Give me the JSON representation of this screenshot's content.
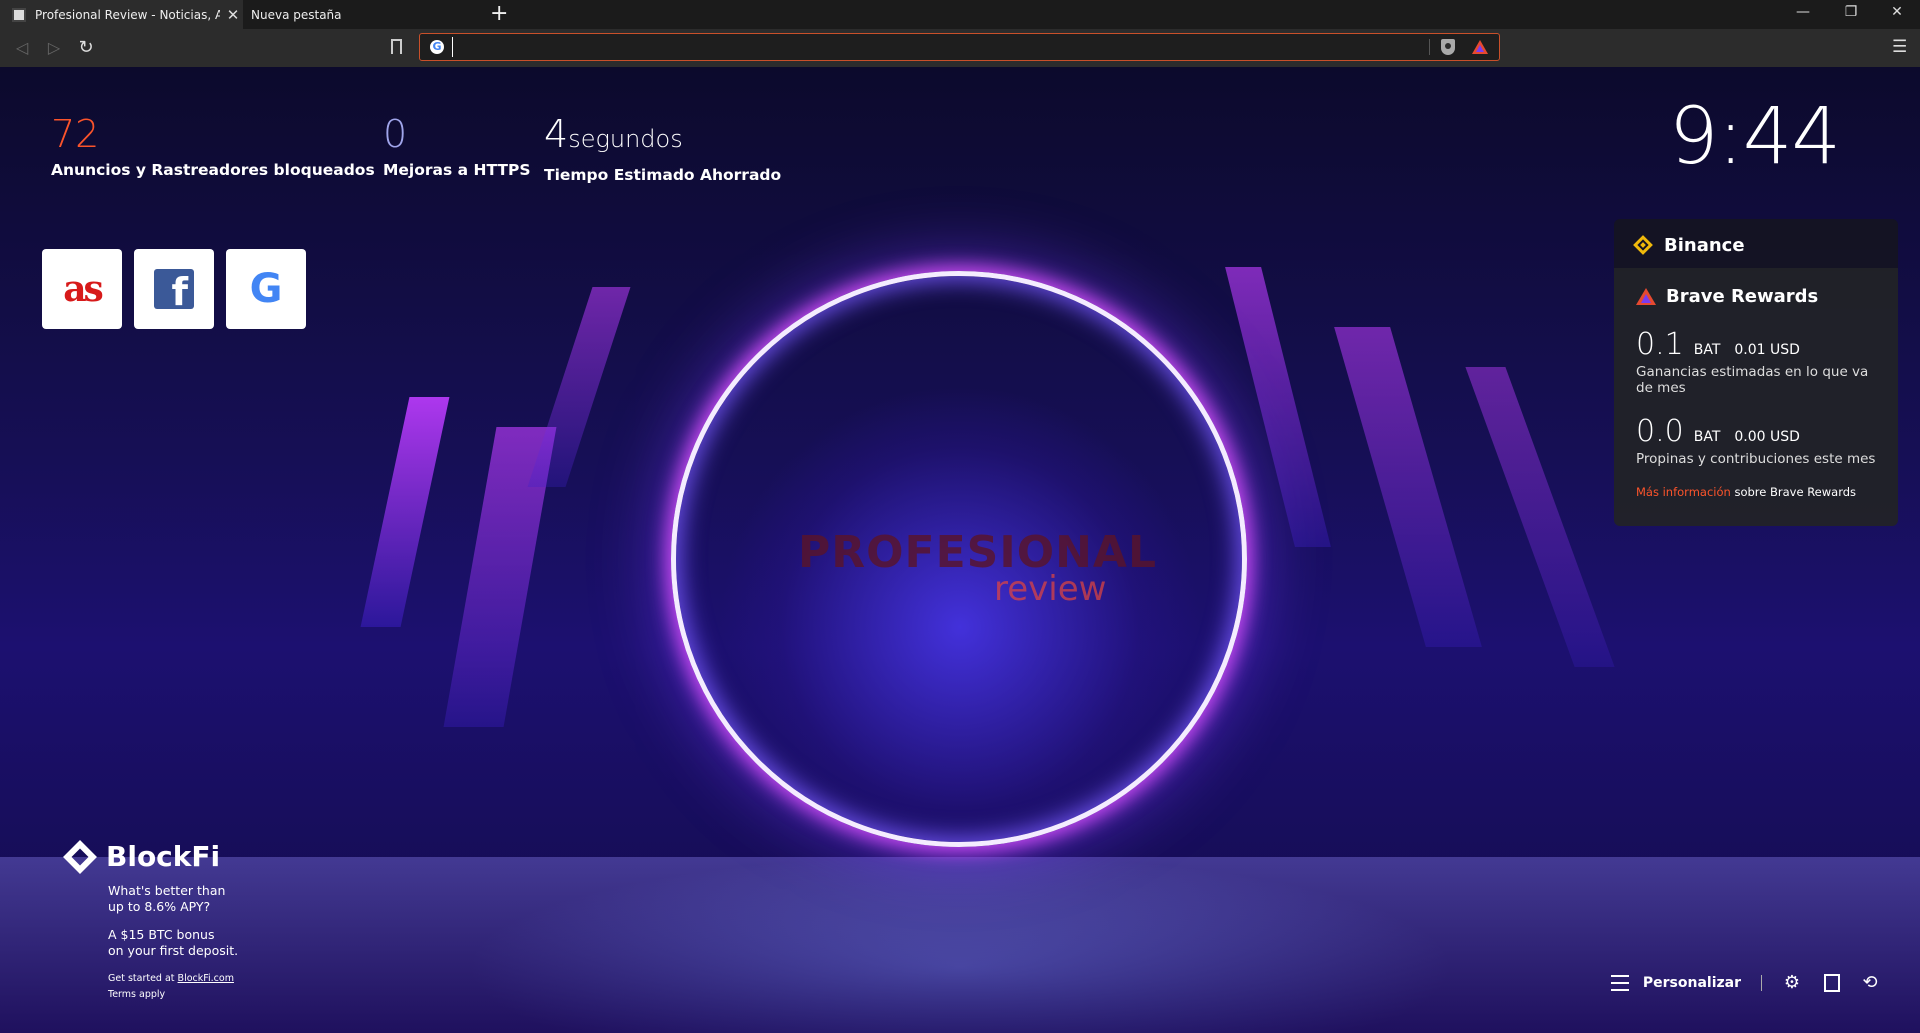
{
  "tabs": [
    {
      "title": "Profesional Review - Noticias, Análisis",
      "close": "✕"
    },
    {
      "title": "Nueva pestaña",
      "close": ""
    }
  ],
  "new_tab": "+",
  "window_controls": {
    "minimize": "—",
    "restore": "❐",
    "close": "✕"
  },
  "toolbar": {
    "back": "◁",
    "forward": "▷",
    "reload": "↻",
    "url_value": "",
    "search_engine": "G",
    "menu": "☰"
  },
  "stats": {
    "ads": {
      "value": "72",
      "label": "Anuncios y Rastreadores bloqueados"
    },
    "https": {
      "value": "0",
      "label": "Mejoras a HTTPS"
    },
    "time": {
      "value": "4",
      "unit": "segundos",
      "label": "Tiempo Estimado Ahorrado"
    }
  },
  "clock": "9:44",
  "top_sites": [
    {
      "name": "as",
      "glyph": "as"
    },
    {
      "name": "facebook",
      "glyph": "f"
    },
    {
      "name": "google",
      "glyph": "G"
    }
  ],
  "watermark": {
    "top": "PROFESIONAL",
    "bottom": "review"
  },
  "widgets": {
    "binance": {
      "title": "Binance"
    },
    "rewards": {
      "title": "Brave Rewards",
      "earnings": {
        "value": "0.1",
        "unit": "BAT",
        "usd": "0.01 USD",
        "desc": "Ganancias estimadas en lo que va de mes"
      },
      "tips": {
        "value": "0.0",
        "unit": "BAT",
        "usd": "0.00 USD",
        "desc": "Propinas y contribuciones este mes"
      },
      "more_link": "Más información",
      "more_suffix": "sobre Brave Rewards"
    }
  },
  "blockfi": {
    "name": "BlockFi",
    "line1": "What's better than",
    "line2": "up to 8.6% APY?",
    "line3": "A $15 BTC bonus",
    "line4": "on your first deposit.",
    "cta_prefix": "Get started at ",
    "cta_link": "BlockFi.com",
    "terms": "Terms apply"
  },
  "bottom": {
    "customize": "Personalizar",
    "settings_glyph": "⚙",
    "history_glyph": "⟲"
  },
  "colors": {
    "accent": "#fb542b",
    "https_blue": "#a0a5eb",
    "binance_yellow": "#f0b90b"
  }
}
